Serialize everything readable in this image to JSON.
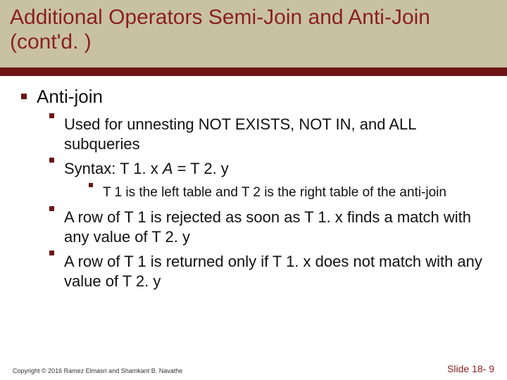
{
  "title": "Additional Operators Semi-Join and Anti-Join (cont'd. )",
  "lvl1": "Anti-join",
  "b1": "Used for unnesting NOT EXISTS, NOT IN, and ALL subqueries",
  "b2a": "Syntax: T 1. x ",
  "b2b": "A",
  "b2c": " = T 2. y",
  "b2_1": "T 1 is the left table and T 2 is the right table of the anti-join",
  "b3": "A row of T 1 is rejected as soon as T 1. x finds a match with any value of T 2. y",
  "b4": "A row of T 1 is returned only if T 1. x does not match with any value of T 2. y",
  "copyright": "Copyright © 2016 Ramez Elmasri and Shamkant B. Navathe",
  "slidenum": "Slide 18- 9"
}
